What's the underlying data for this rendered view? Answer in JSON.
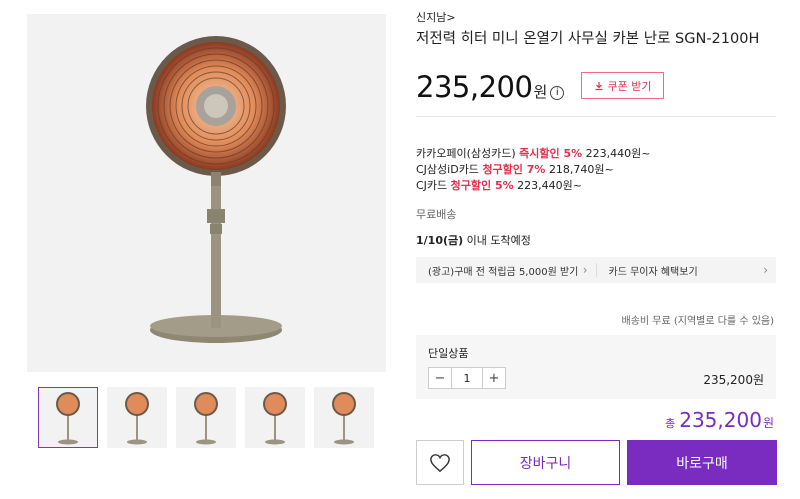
{
  "product": {
    "seller": "신지남>",
    "title": "저전력 히터 미니 온열기 사무실 카본 난로 SGN-2100H",
    "price": "235,200",
    "price_unit": "원",
    "info_icon": "i",
    "coupon_label": "쿠폰 받기",
    "coupon_icon": "download-icon"
  },
  "card_offers": [
    {
      "prefix": "카카오페이(삼성카드)",
      "highlight": "즉시할인 5%",
      "suffix": "223,440원~"
    },
    {
      "prefix": "CJ삼성iD카드",
      "highlight": "청구할인 7%",
      "suffix": "218,740원~"
    },
    {
      "prefix": "CJ카드",
      "highlight": "청구할인 5%",
      "suffix": "223,440원~"
    }
  ],
  "shipping": {
    "free": "무료배송",
    "arrival_date": "1/10(금)",
    "arrival_text": " 이내 도착예정",
    "note": "배송비 무료 (지역별로 다를 수 있음)"
  },
  "promo": {
    "left": "(광고)구매 전 적립금 5,000원 받기",
    "right": "카드 무이자 혜택보기",
    "chevron": "›"
  },
  "option": {
    "label": "단일상품",
    "minus": "−",
    "qty": "1",
    "plus": "+",
    "price": "235,200원"
  },
  "total": {
    "label": "총",
    "amount": "235,200",
    "unit": "원"
  },
  "buttons": {
    "cart": "장바구니",
    "buy": "바로구매",
    "wish_icon": "heart-icon"
  },
  "colors": {
    "accent": "#7a2bc0",
    "sale": "#e0314f"
  }
}
